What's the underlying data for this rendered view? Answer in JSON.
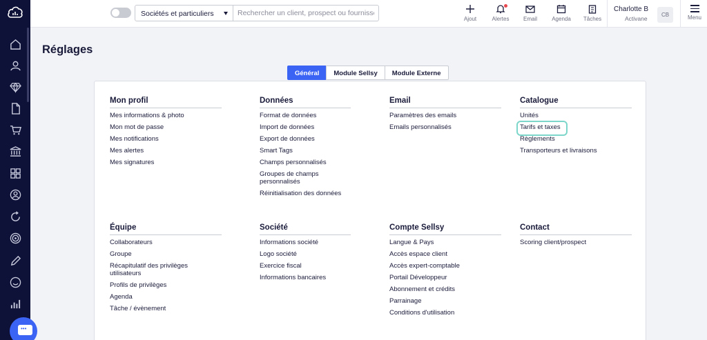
{
  "sidebar": {
    "items": [
      {
        "name": "home-icon"
      },
      {
        "name": "person-icon"
      },
      {
        "name": "diamond-icon"
      },
      {
        "name": "document-icon"
      },
      {
        "name": "cart-icon"
      },
      {
        "name": "bank-icon"
      },
      {
        "name": "grid-icon"
      },
      {
        "name": "contact-icon"
      },
      {
        "name": "refresh-icon"
      },
      {
        "name": "target-icon"
      },
      {
        "name": "pencil-icon"
      },
      {
        "name": "smiley-icon"
      },
      {
        "name": "bar-chart-icon"
      }
    ]
  },
  "topbar": {
    "scope_select": "Sociétés et particuliers",
    "search_placeholder": "Rechercher un client, prospect ou fournisseur",
    "tools": {
      "add": "Ajout",
      "alerts": "Alertes",
      "email": "Email",
      "agenda": "Agenda",
      "tasks": "Tâches"
    },
    "user_name": "Charlotte B",
    "user_org": "Activane",
    "avatar_initials": "CB",
    "menu": "Menu"
  },
  "page": {
    "title": "Réglages",
    "tabs": [
      "Général",
      "Module Sellsy",
      "Module Externe"
    ],
    "active_tab": "Général"
  },
  "sections": {
    "profil": {
      "title": "Mon profil",
      "links": [
        "Mes informations & photo",
        "Mon mot de passe",
        "Mes notifications",
        "Mes alertes",
        "Mes signatures"
      ]
    },
    "donnees": {
      "title": "Données",
      "links": [
        "Format de données",
        "Import de données",
        "Export de données",
        "Smart Tags",
        "Champs personnalisés",
        "Groupes de champs personnalisés",
        "Réinitialisation des données"
      ]
    },
    "email": {
      "title": "Email",
      "links": [
        "Paramètres des emails",
        "Emails personnalisés"
      ]
    },
    "catalogue": {
      "title": "Catalogue",
      "links": [
        "Unités",
        "Tarifs et taxes",
        "Règlements",
        "Transporteurs et livraisons"
      ]
    },
    "equipe": {
      "title": "Équipe",
      "links": [
        "Collaborateurs",
        "Groupe",
        "Récapitulatif des privilèges utilisateurs",
        "Profils de privilèges",
        "Agenda",
        "Tâche / évènement"
      ]
    },
    "societe": {
      "title": "Société",
      "links": [
        "Informations société",
        "Logo société",
        "Exercice fiscal",
        "Informations bancaires"
      ]
    },
    "compte": {
      "title": "Compte Sellsy",
      "links": [
        "Langue & Pays",
        "Accès espace client",
        "Accès expert-comptable",
        "Portail Développeur",
        "Abonnement et crédits",
        "Parrainage",
        "Conditions d'utilisation"
      ]
    },
    "contact": {
      "title": "Contact",
      "links": [
        "Scoring client/prospect"
      ]
    }
  },
  "colors": {
    "sidebar": "#0f1238",
    "accent": "#3c64f4",
    "highlight": "#7cd6c9",
    "alert_dot": "#e8484f"
  }
}
